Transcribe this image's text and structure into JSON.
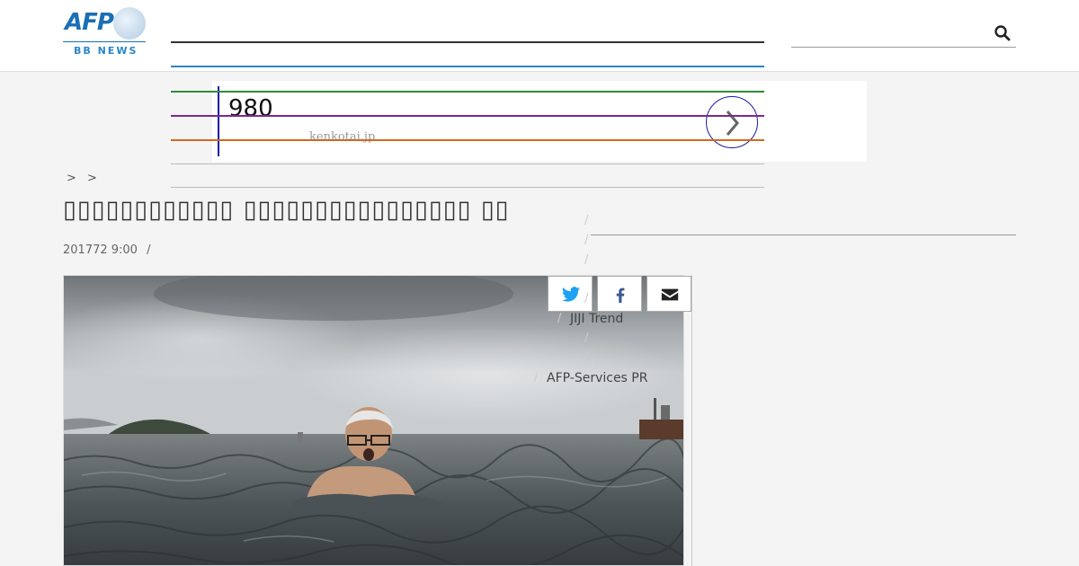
{
  "header": {
    "logo_text": "AFP",
    "logo_subtext": "BB NEWS",
    "search": {
      "value": "",
      "placeholder": ""
    }
  },
  "ad": {
    "price": "980",
    "domain": "kenkotai.jp",
    "close_symbol": "✕",
    "info_symbol": "ⓘ"
  },
  "breadcrumb": {
    "separators": [
      ">",
      ">"
    ]
  },
  "article": {
    "title": "▯▯▯▯▯▯▯▯▯▯▯▯ ▯▯▯▯▯▯▯▯▯▯▯▯▯▯▯▯ ▯▯",
    "date": "201772 9:00",
    "meta_separator": "/"
  },
  "sidebar": {
    "links": [
      "JIJI Trend",
      "AFP-Services PR"
    ],
    "slash": "/"
  },
  "colors": {
    "brand_blue": "#1b6fb5",
    "nav_green": "#2e8b3a",
    "nav_purple": "#7a2a8c",
    "nav_orange": "#d2691e",
    "twitter": "#1da1f2",
    "facebook": "#3b5998"
  }
}
